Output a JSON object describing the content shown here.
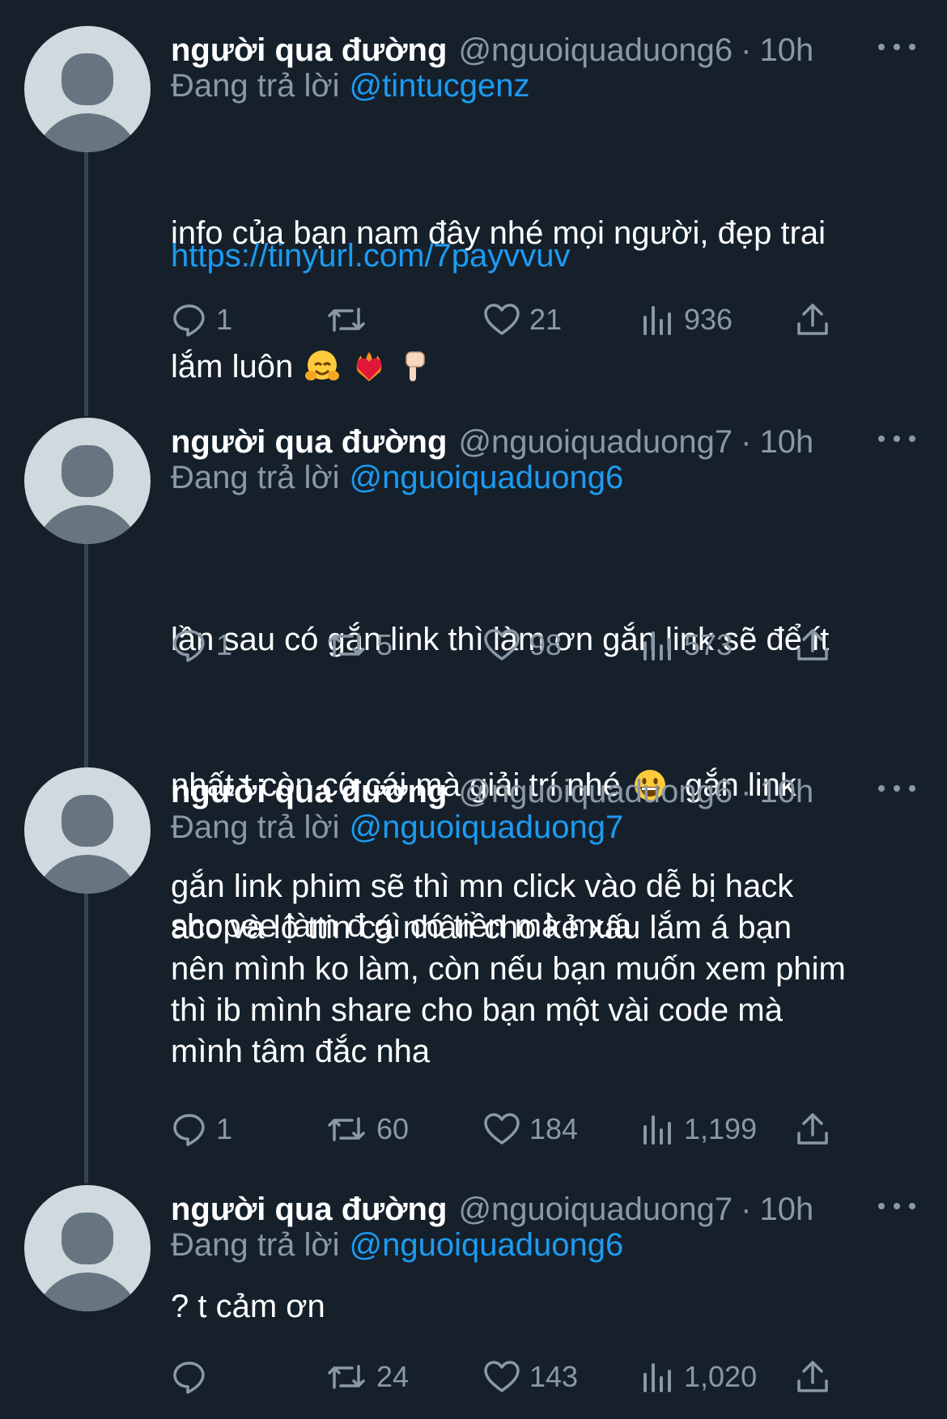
{
  "reply_prefix": "Đang trả lời",
  "colors": {
    "background": "#15202b",
    "link": "#1d9bf0",
    "muted": "#8b98a5"
  },
  "tweets": [
    {
      "name": "người qua đường",
      "handle": "@nguoiquaduong6",
      "dot": "·",
      "time": "10h",
      "reply_to": "@tintucgenz",
      "text_line1": "info của bạn nam đây nhé mọi người, đẹp trai",
      "text_line2": "lắm luôn",
      "emojis": [
        "hugging-face",
        "heart-on-fire",
        "pointing-down"
      ],
      "link": "https://tinyurl.com/7payvvuv",
      "replies": "1",
      "retweets": "",
      "likes": "21",
      "views": "936"
    },
    {
      "name": "người qua đường",
      "handle": "@nguoiquaduong7",
      "dot": "·",
      "time": "10h",
      "reply_to": "@nguoiquaduong6",
      "text_line1": "lần sau có gắn link thì làm ơn gắn link sẽ để ít",
      "text_line2": "nhất t còn có cái mà giải trí nhé",
      "text_line2b": " gắn link",
      "text_line3": "shopee làm đ gì có tiền mà mua",
      "emojis": [
        "grinning-face"
      ],
      "replies": "1",
      "retweets": "5",
      "likes": "98",
      "views": "573"
    },
    {
      "name": "người qua đường",
      "handle": "@nguoiquaduong6",
      "dot": "·",
      "time": "10h",
      "reply_to": "@nguoiquaduong7",
      "text": "gắn link phim sẽ thì mn click vào dễ bị hack\nacc và lộ ttin cá nhân cho kẻ xấu lắm á bạn\nnên mình ko làm, còn nếu bạn muốn xem phim\nthì ib mình share cho bạn một vài code mà\nmình tâm đắc nha",
      "replies": "1",
      "retweets": "60",
      "likes": "184",
      "views": "1,199"
    },
    {
      "name": "người qua đường",
      "handle": "@nguoiquaduong7",
      "dot": "·",
      "time": "10h",
      "reply_to": "@nguoiquaduong6",
      "text": "? t cảm ơn",
      "replies": "",
      "retweets": "24",
      "likes": "143",
      "views": "1,020"
    }
  ]
}
